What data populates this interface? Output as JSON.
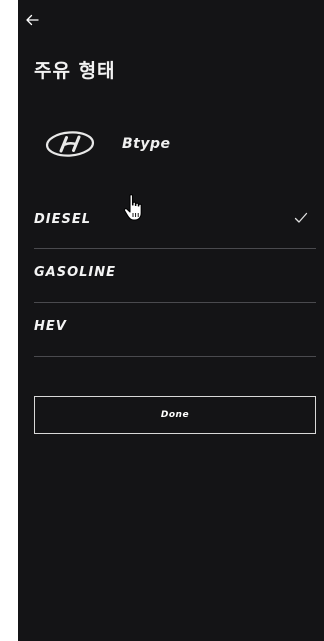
{
  "header": {
    "back_icon": "arrow-left-icon",
    "title": "주유 형태"
  },
  "brand": {
    "logo": "hyundai-logo",
    "model": "Btype"
  },
  "fuel_options": [
    {
      "label": "DIESEL",
      "selected": true
    },
    {
      "label": "GASOLINE",
      "selected": false
    },
    {
      "label": "HEV",
      "selected": false
    }
  ],
  "selected_check_icon": "checkmark-icon",
  "cursor_icon": "hand-pointer-icon",
  "done_button": {
    "label": "Done"
  },
  "colors": {
    "background": "#141416",
    "divider": "#4a4a4e",
    "text": "#ffffff"
  }
}
